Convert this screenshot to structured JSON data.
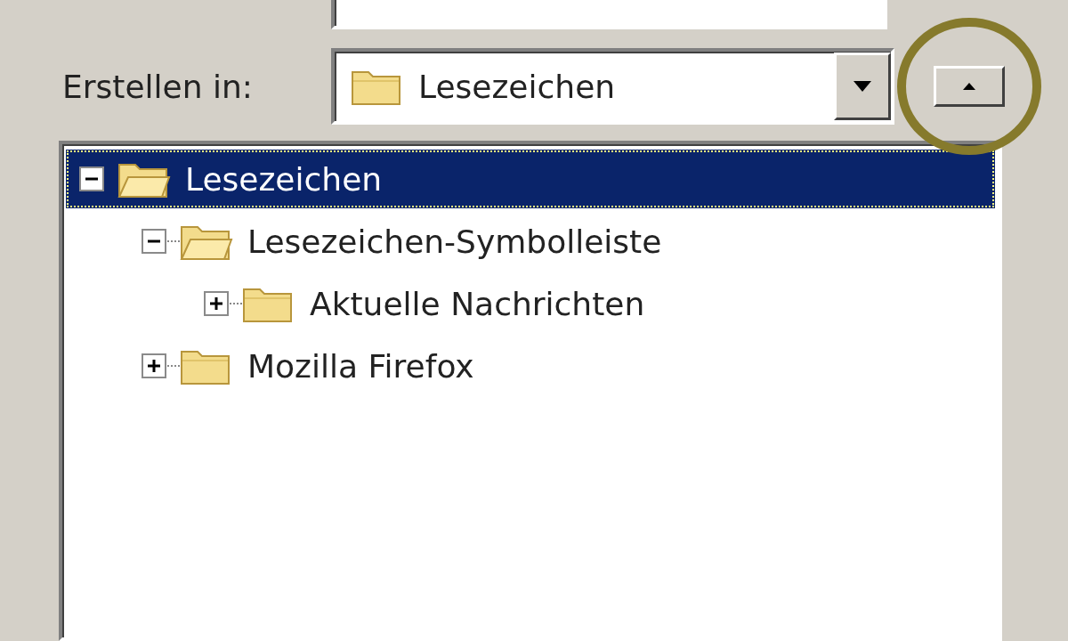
{
  "folder_row": {
    "label": "Erstellen in:",
    "value": "Lesezeichen"
  },
  "tree": [
    {
      "label": "Lesezeichen",
      "selected": true,
      "expanded": true,
      "children": [
        {
          "label": "Lesezeichen-Symbolleiste",
          "selected": false,
          "expanded": true,
          "children": [
            {
              "label": "Aktuelle Nachrichten",
              "selected": false,
              "expanded": false
            }
          ]
        },
        {
          "label": "Mozilla Firefox",
          "selected": false,
          "expanded": false
        }
      ]
    }
  ]
}
